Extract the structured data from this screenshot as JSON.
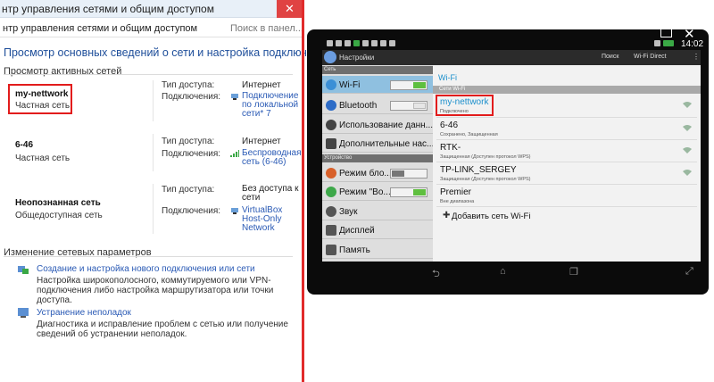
{
  "windows_panel": {
    "title": "нтр управления сетями и общим доступом",
    "address": "нтр управления сетями и общим доступом",
    "address_search": "Поиск в панел...",
    "heading": "Просмотр основных сведений о сети и настройка подключений",
    "active_networks_label": "Просмотр активных сетей",
    "access_type_label": "Тип доступа:",
    "connections_label": "Подключения:",
    "networks": [
      {
        "name": "my-nettwork",
        "category": "Частная сеть",
        "access": "Интернет",
        "connection": "Подключение по локальной сети* 7"
      },
      {
        "name": "6-46",
        "category": "Частная сеть",
        "access": "Интернет",
        "connection": "Беспроводная сеть (6-46)"
      },
      {
        "name": "Неопознанная сеть",
        "category": "Общедоступная сеть",
        "access": "Без доступа к сети",
        "connection": "VirtualBox Host-Only Network"
      }
    ],
    "change_settings_label": "Изменение сетевых параметров",
    "tasks": [
      {
        "link": "Создание и настройка нового подключения или сети",
        "desc": "Настройка широкополосного, коммутируемого или VPN-подключения либо настройка маршрутизатора или точки доступа."
      },
      {
        "link": "Устранение неполадок",
        "desc": "Диагностика и исправление проблем с сетью или получение сведений об устранении неполадок."
      }
    ],
    "close_icon": "close-icon"
  },
  "tablet": {
    "time": "14:02",
    "actionbar": {
      "title": "Настройки",
      "search": "Поиск",
      "wifi_direct": "Wi-Fi Direct"
    },
    "categories": {
      "network": "Сеть",
      "device": "Устройство"
    },
    "menu": [
      {
        "label": "Wi-Fi",
        "icon": "wifi-icon",
        "color": "#3b8fd6"
      },
      {
        "label": "Bluetooth",
        "icon": "bluetooth-icon",
        "color": "#2e6cc7"
      },
      {
        "label": "Использование данн...",
        "icon": "data-usage-icon",
        "color": "#444444"
      },
      {
        "label": "Дополнительные нас...",
        "icon": "more-settings-icon",
        "color": "#444444"
      },
      {
        "label": "Режим бло...",
        "icon": "block-mode-icon",
        "color": "#d8602a"
      },
      {
        "label": "Режим \"Во...",
        "icon": "driving-mode-icon",
        "color": "#3ea84a"
      },
      {
        "label": "Звук",
        "icon": "sound-icon",
        "color": "#555555"
      },
      {
        "label": "Дисплей",
        "icon": "display-icon",
        "color": "#555555"
      },
      {
        "label": "Память",
        "icon": "storage-icon",
        "color": "#555555"
      }
    ],
    "wifi": {
      "title": "Wi-Fi",
      "subheader": "Сети Wi-Fi",
      "networks": [
        {
          "name": "my-nettwork",
          "status": "Подключено"
        },
        {
          "name": "6-46",
          "status": "Сохранено, Защищенная"
        },
        {
          "name": "RTK-",
          "status": "Защищенная (Доступен протокол WPS)"
        },
        {
          "name": "TP-LINK_SERGEY",
          "status": "Защищенная (Доступен протокол WPS)"
        },
        {
          "name": "Premier",
          "status": "Вне диапазона"
        }
      ],
      "add_network": "Добавить сеть Wi-Fi"
    }
  },
  "colors": {
    "highlight": "#e21c1c",
    "link": "#2a5ab5",
    "android_accent": "#1b8fcc"
  }
}
